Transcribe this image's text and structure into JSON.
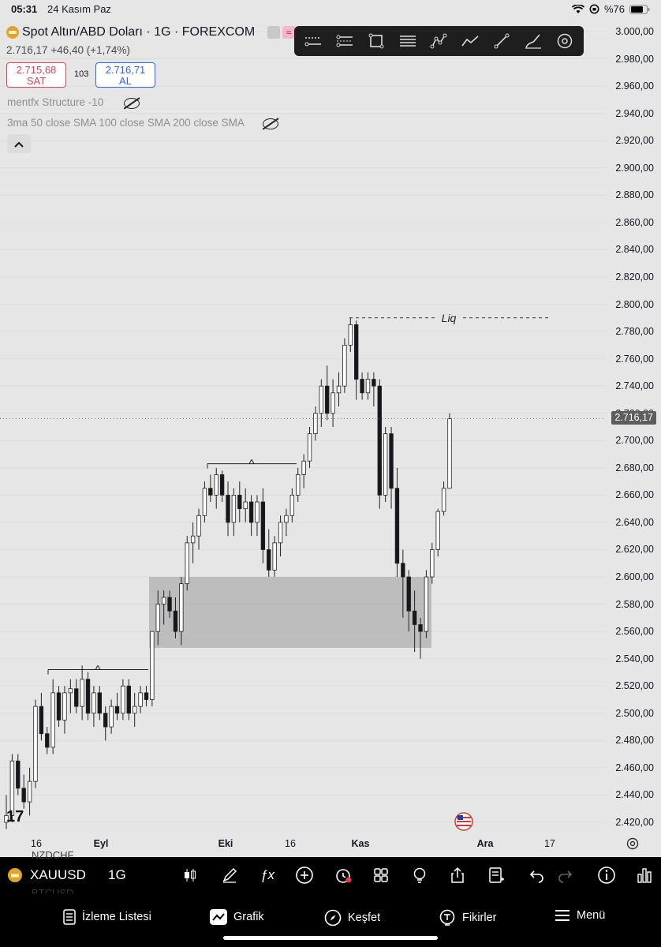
{
  "status_bar": {
    "time": "05:31",
    "date": "24 Kasım Paz",
    "battery": "%76"
  },
  "header": {
    "title": "Spot Altın/ABD Doları · 1G · FOREXCOM",
    "last_price": "2.716,17",
    "change": "+46,40 (+1,74%)",
    "sell_price": "2.715,68",
    "sell_label": "SAT",
    "spread": "103",
    "buy_price": "2.716,71",
    "buy_label": "AL"
  },
  "indicators": [
    {
      "label": "mentfx Structure -10"
    },
    {
      "label": "3ma 50 close SMA 100 close SMA 200 close SMA"
    }
  ],
  "price_axis": {
    "ticks": [
      "3.000,00",
      "2.980,00",
      "2.960,00",
      "2.940,00",
      "2.920,00",
      "2.900,00",
      "2.880,00",
      "2.860,00",
      "2.840,00",
      "2.820,00",
      "2.800,00",
      "2.780,00",
      "2.760,00",
      "2.740,00",
      "2.720,00",
      "2.700,00",
      "2.680,00",
      "2.660,00",
      "2.640,00",
      "2.620,00",
      "2.600,00",
      "2.580,00",
      "2.560,00",
      "2.540,00",
      "2.520,00",
      "2.500,00",
      "2.480,00",
      "2.460,00",
      "2.440,00",
      "2.420,00"
    ],
    "current_price_label": "2.716,17"
  },
  "time_axis": {
    "labels": [
      {
        "text": "16",
        "bold": false
      },
      {
        "text": "Eyl",
        "bold": true
      },
      {
        "text": "Eki",
        "bold": true
      },
      {
        "text": "16",
        "bold": false
      },
      {
        "text": "Kas",
        "bold": true
      },
      {
        "text": "Ara",
        "bold": true
      },
      {
        "text": "17",
        "bold": false
      }
    ]
  },
  "annotations": {
    "liq_label": "Liq",
    "caret_1": "^",
    "caret_2": "^"
  },
  "chart_data": {
    "type": "candlestick",
    "symbol": "XAUUSD",
    "timeframe": "1G",
    "ylim": [
      2410,
      3005
    ],
    "current_price": 2716.17,
    "liq_level": 2790,
    "zone": {
      "high": 2600,
      "low": 2548
    },
    "structure_levels": [
      2683,
      2532
    ],
    "candles": [
      [
        2420,
        2440,
        2415,
        2425
      ],
      [
        2425,
        2470,
        2420,
        2465
      ],
      [
        2465,
        2470,
        2440,
        2445
      ],
      [
        2445,
        2455,
        2430,
        2435
      ],
      [
        2435,
        2460,
        2425,
        2450
      ],
      [
        2450,
        2510,
        2445,
        2505
      ],
      [
        2505,
        2515,
        2480,
        2485
      ],
      [
        2485,
        2490,
        2470,
        2475
      ],
      [
        2475,
        2525,
        2470,
        2515
      ],
      [
        2515,
        2520,
        2490,
        2495
      ],
      [
        2495,
        2520,
        2485,
        2515
      ],
      [
        2515,
        2525,
        2500,
        2518
      ],
      [
        2518,
        2525,
        2500,
        2505
      ],
      [
        2505,
        2535,
        2495,
        2525
      ],
      [
        2525,
        2530,
        2495,
        2500
      ],
      [
        2500,
        2520,
        2490,
        2515
      ],
      [
        2515,
        2520,
        2495,
        2500
      ],
      [
        2500,
        2505,
        2480,
        2490
      ],
      [
        2490,
        2510,
        2485,
        2505
      ],
      [
        2505,
        2515,
        2495,
        2500
      ],
      [
        2500,
        2525,
        2495,
        2520
      ],
      [
        2520,
        2525,
        2495,
        2500
      ],
      [
        2500,
        2515,
        2490,
        2505
      ],
      [
        2505,
        2520,
        2500,
        2515
      ],
      [
        2515,
        2520,
        2505,
        2510
      ],
      [
        2510,
        2560,
        2505,
        2560
      ],
      [
        2560,
        2590,
        2550,
        2580
      ],
      [
        2580,
        2590,
        2565,
        2585
      ],
      [
        2585,
        2590,
        2570,
        2575
      ],
      [
        2575,
        2585,
        2555,
        2560
      ],
      [
        2560,
        2600,
        2550,
        2595
      ],
      [
        2595,
        2630,
        2590,
        2625
      ],
      [
        2625,
        2640,
        2610,
        2630
      ],
      [
        2630,
        2650,
        2620,
        2645
      ],
      [
        2645,
        2670,
        2640,
        2665
      ],
      [
        2665,
        2675,
        2655,
        2660
      ],
      [
        2660,
        2680,
        2650,
        2675
      ],
      [
        2675,
        2678,
        2655,
        2660
      ],
      [
        2660,
        2670,
        2630,
        2640
      ],
      [
        2640,
        2665,
        2630,
        2660
      ],
      [
        2660,
        2670,
        2640,
        2650
      ],
      [
        2650,
        2665,
        2640,
        2655
      ],
      [
        2655,
        2660,
        2630,
        2640
      ],
      [
        2640,
        2660,
        2630,
        2655
      ],
      [
        2655,
        2665,
        2610,
        2620
      ],
      [
        2620,
        2635,
        2600,
        2605
      ],
      [
        2605,
        2630,
        2600,
        2625
      ],
      [
        2625,
        2645,
        2615,
        2640
      ],
      [
        2640,
        2650,
        2630,
        2645
      ],
      [
        2645,
        2665,
        2640,
        2660
      ],
      [
        2660,
        2680,
        2655,
        2675
      ],
      [
        2675,
        2690,
        2665,
        2685
      ],
      [
        2685,
        2710,
        2680,
        2705
      ],
      [
        2705,
        2725,
        2700,
        2720
      ],
      [
        2720,
        2745,
        2710,
        2740
      ],
      [
        2740,
        2755,
        2715,
        2720
      ],
      [
        2720,
        2745,
        2710,
        2735
      ],
      [
        2735,
        2750,
        2725,
        2740
      ],
      [
        2740,
        2775,
        2735,
        2770
      ],
      [
        2770,
        2790,
        2765,
        2785
      ],
      [
        2785,
        2788,
        2730,
        2745
      ],
      [
        2745,
        2750,
        2730,
        2735
      ],
      [
        2735,
        2750,
        2730,
        2745
      ],
      [
        2745,
        2750,
        2725,
        2740
      ],
      [
        2740,
        2745,
        2650,
        2660
      ],
      [
        2660,
        2710,
        2655,
        2705
      ],
      [
        2705,
        2710,
        2650,
        2665
      ],
      [
        2665,
        2680,
        2600,
        2610
      ],
      [
        2610,
        2620,
        2570,
        2600
      ],
      [
        2600,
        2605,
        2560,
        2575
      ],
      [
        2575,
        2590,
        2545,
        2565
      ],
      [
        2565,
        2570,
        2540,
        2560
      ],
      [
        2560,
        2605,
        2555,
        2600
      ],
      [
        2600,
        2625,
        2595,
        2620
      ],
      [
        2620,
        2650,
        2615,
        2648
      ],
      [
        2648,
        2670,
        2645,
        2665
      ],
      [
        2665,
        2720,
        2665,
        2716
      ]
    ]
  },
  "symbol_bar": {
    "symbol": "XAUUSD",
    "timeframe": "1G",
    "ghost_above": "NZDCHF",
    "ghost_below": "BTCUSD"
  },
  "tabs": [
    {
      "label": "İzleme Listesi",
      "icon": "watchlist-icon"
    },
    {
      "label": "Grafik",
      "icon": "chart-icon"
    },
    {
      "label": "Keşfet",
      "icon": "compass-icon"
    },
    {
      "label": "Fikirler",
      "icon": "ideas-icon"
    },
    {
      "label": "Menü",
      "icon": "menu-icon"
    }
  ]
}
